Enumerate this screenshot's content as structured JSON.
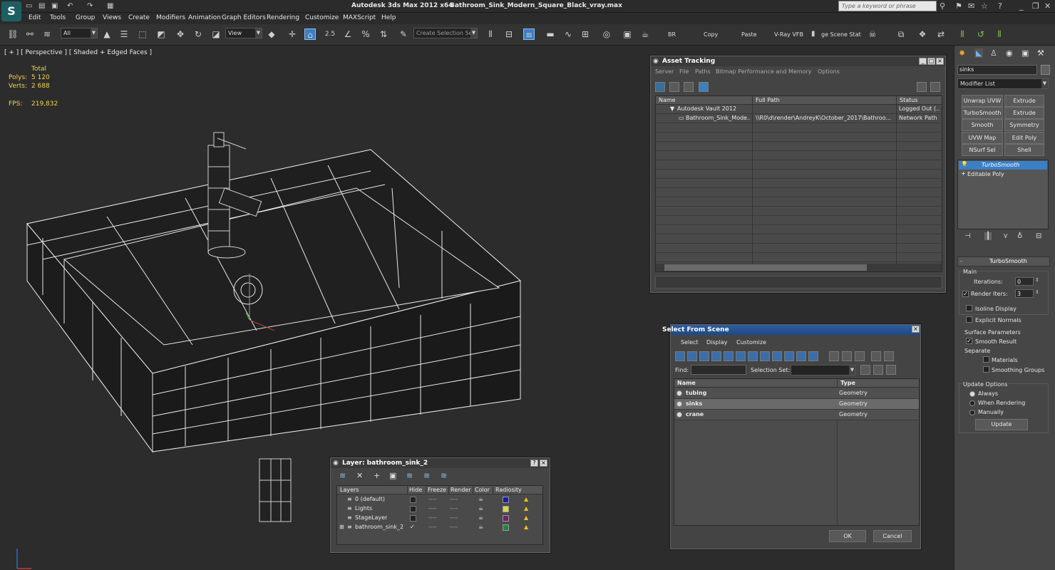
{
  "title_bar": {
    "app": "Autodesk 3ds Max  2012 x64",
    "file": "Bathroom_Sink_Modern_Square_Black_vray.max",
    "search_placeholder": "Type a keyword or phrase"
  },
  "menu": [
    "Edit",
    "Tools",
    "Group",
    "Views",
    "Create",
    "Modifiers",
    "Animation",
    "Graph Editors",
    "Rendering",
    "Customize",
    "MAXScript",
    "Help"
  ],
  "toolbar": {
    "filter": "All",
    "ref_coord": "View",
    "snap_label": "2.5",
    "selection_set_placeholder": "Create Selection Se",
    "render_buttons": [
      "BR",
      "Copy",
      "Paste",
      "V-Ray VFB",
      "ge Scene Stat"
    ]
  },
  "viewport": {
    "label": "[ + ] [ Perspective ] [ Shaded + Edged Faces ]",
    "stats": {
      "total_label": "Total",
      "polys_label": "Polys:",
      "polys": "5 120",
      "verts_label": "Verts:",
      "verts": "2 688",
      "fps_label": "FPS:",
      "fps": "219,832"
    }
  },
  "asset_tracking": {
    "title": "Asset Tracking",
    "menu": [
      "Server",
      "File",
      "Paths",
      "Bitmap Performance and Memory",
      "Options"
    ],
    "columns": [
      "Name",
      "Full Path",
      "Status"
    ],
    "rows": [
      {
        "name": "Autodesk Vault 2012",
        "path": "",
        "status": "Logged Out (..."
      },
      {
        "name": "Bathroom_Sink_Mode...",
        "path": "\\\\R0\\d\\render\\AndreyK\\October_2017\\Bathroo...",
        "status": "Network Path"
      }
    ]
  },
  "select_from_scene": {
    "title": "Select From Scene",
    "menu": [
      "Select",
      "Display",
      "Customize"
    ],
    "find_label": "Find:",
    "selset_label": "Selection Set:",
    "columns": [
      "Name",
      "Type"
    ],
    "rows": [
      {
        "name": "tubing",
        "type": "Geometry"
      },
      {
        "name": "sinks",
        "type": "Geometry"
      },
      {
        "name": "crane",
        "type": "Geometry"
      }
    ],
    "ok": "OK",
    "cancel": "Cancel"
  },
  "layer_manager": {
    "title": "Layer: bathroom_sink_2",
    "columns": [
      "Layers",
      "Hide",
      "Freeze",
      "Render",
      "Color",
      "Radiosity"
    ],
    "rows": [
      {
        "name": "0 (default)",
        "color": "#1c1ca8",
        "current": false
      },
      {
        "name": "Lights",
        "color": "#d8d84a",
        "current": false
      },
      {
        "name": "StageLayer",
        "color": "#7a1a7a",
        "current": false
      },
      {
        "name": "bathroom_sink_2",
        "color": "#1a8a3a",
        "current": true
      }
    ]
  },
  "command_panel": {
    "object_name": "sinks",
    "modifier_list": "Modifier List",
    "buttons": [
      "Unwrap UVW",
      "Extrude",
      "TurboSmooth",
      "Extrude",
      "Smooth",
      "Symmetry",
      "UVW Map",
      "Edit Poly",
      "NSurf Sel",
      "Shell"
    ],
    "stack": [
      "TurboSmooth",
      "Editable Poly"
    ],
    "turbosmooth": {
      "rollout": "TurboSmooth",
      "main": "Main",
      "iterations_label": "Iterations:",
      "iterations": "0",
      "render_iters_label": "Render Iters:",
      "render_iters": "3",
      "isoline": "Isoline Display",
      "explicit": "Explicit Normals",
      "surface": "Surface Parameters",
      "smooth_result": "Smooth Result",
      "separate": "Separate",
      "materials": "Materials",
      "smoothing_groups": "Smoothing Groups",
      "update_options": "Update Options",
      "always": "Always",
      "when_rendering": "When Rendering",
      "manually": "Manually",
      "update": "Update"
    }
  }
}
